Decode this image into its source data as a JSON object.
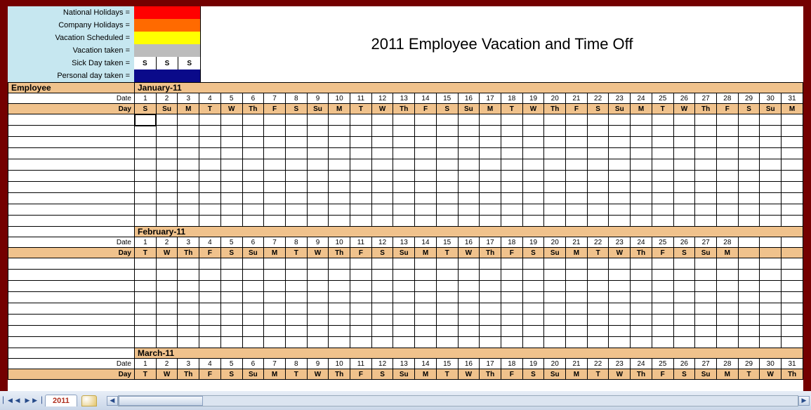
{
  "title": "2011 Employee Vacation and Time Off",
  "legend": {
    "national": {
      "label": "National Holidays =",
      "color": "#ff0000"
    },
    "company": {
      "label": "Company Holidays =",
      "color": "#ff6a00"
    },
    "vacation_scheduled": {
      "label": "Vacation Scheduled =",
      "color": "#ffff00"
    },
    "vacation_taken": {
      "label": "Vacation taken =",
      "color": "#bcbcbc"
    },
    "sick": {
      "label": "Sick Day taken =",
      "color": "#ffffff",
      "mark": "S"
    },
    "personal": {
      "label": "Personal day taken =",
      "color": "#0a0a8a"
    }
  },
  "headers": {
    "employee": "Employee",
    "date": "Date",
    "day": "Day"
  },
  "months": [
    {
      "name": "January-11",
      "dates": [
        "1",
        "2",
        "3",
        "4",
        "5",
        "6",
        "7",
        "8",
        "9",
        "10",
        "11",
        "12",
        "13",
        "14",
        "15",
        "16",
        "17",
        "18",
        "19",
        "20",
        "21",
        "22",
        "23",
        "24",
        "25",
        "26",
        "27",
        "28",
        "29",
        "30",
        "31"
      ],
      "days": [
        "S",
        "Su",
        "M",
        "T",
        "W",
        "Th",
        "F",
        "S",
        "Su",
        "M",
        "T",
        "W",
        "Th",
        "F",
        "S",
        "Su",
        "M",
        "T",
        "W",
        "Th",
        "F",
        "S",
        "Su",
        "M",
        "T",
        "W",
        "Th",
        "F",
        "S",
        "Su",
        "M"
      ],
      "rows": 10
    },
    {
      "name": "February-11",
      "dates": [
        "1",
        "2",
        "3",
        "4",
        "5",
        "6",
        "7",
        "8",
        "9",
        "10",
        "11",
        "12",
        "13",
        "14",
        "15",
        "16",
        "17",
        "18",
        "19",
        "20",
        "21",
        "22",
        "23",
        "24",
        "25",
        "26",
        "27",
        "28",
        "",
        "",
        ""
      ],
      "days": [
        "T",
        "W",
        "Th",
        "F",
        "S",
        "Su",
        "M",
        "T",
        "W",
        "Th",
        "F",
        "S",
        "Su",
        "M",
        "T",
        "W",
        "Th",
        "F",
        "S",
        "Su",
        "M",
        "T",
        "W",
        "Th",
        "F",
        "S",
        "Su",
        "M",
        "",
        "",
        ""
      ],
      "rows": 8
    },
    {
      "name": "March-11",
      "dates": [
        "1",
        "2",
        "3",
        "4",
        "5",
        "6",
        "7",
        "8",
        "9",
        "10",
        "11",
        "12",
        "13",
        "14",
        "15",
        "16",
        "17",
        "18",
        "19",
        "20",
        "21",
        "22",
        "23",
        "24",
        "25",
        "26",
        "27",
        "28",
        "29",
        "30",
        "31"
      ],
      "days": [
        "T",
        "W",
        "Th",
        "F",
        "S",
        "Su",
        "M",
        "T",
        "W",
        "Th",
        "F",
        "S",
        "Su",
        "M",
        "T",
        "W",
        "Th",
        "F",
        "S",
        "Su",
        "M",
        "T",
        "W",
        "Th",
        "F",
        "S",
        "Su",
        "M",
        "T",
        "W",
        "Th"
      ],
      "rows": 0
    }
  ],
  "sheet_tab": "2011"
}
